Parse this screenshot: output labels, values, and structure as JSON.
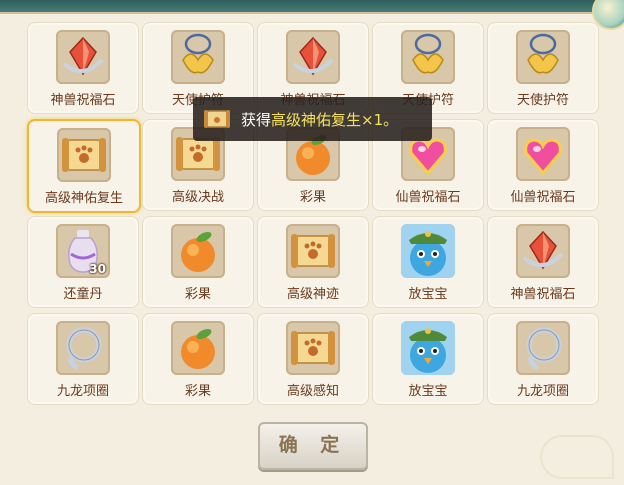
{
  "toast": {
    "icon": "scroll-icon",
    "prefix": "获得",
    "item": "高级神佑复生",
    "suffix": "×1。"
  },
  "button": {
    "confirm_label": "确 定"
  },
  "colors": {
    "selected_border": "#f2b72f",
    "toast_highlight": "#f5e25a",
    "label": "#6a3a1e"
  },
  "items": [
    {
      "name": "神兽祝福石",
      "icon": "red-crystal-icon"
    },
    {
      "name": "天使护符",
      "icon": "angel-wing-amulet-icon"
    },
    {
      "name": "神兽祝福石",
      "icon": "red-crystal-icon"
    },
    {
      "name": "天使护符",
      "icon": "angel-wing-amulet-icon"
    },
    {
      "name": "天使护符",
      "icon": "angel-wing-amulet-icon"
    },
    {
      "name": "高级神佑复生",
      "icon": "paw-scroll-icon",
      "selected": true
    },
    {
      "name": "高级决战",
      "icon": "paw-scroll-icon"
    },
    {
      "name": "彩果",
      "icon": "peach-fruit-icon"
    },
    {
      "name": "仙兽祝福石",
      "icon": "pink-heart-gem-icon"
    },
    {
      "name": "仙兽祝福石",
      "icon": "pink-heart-gem-icon"
    },
    {
      "name": "还童丹",
      "icon": "vase-potion-icon",
      "qty": "30"
    },
    {
      "name": "彩果",
      "icon": "peach-fruit-icon"
    },
    {
      "name": "高级神迹",
      "icon": "paw-scroll-icon"
    },
    {
      "name": "放宝宝",
      "icon": "blue-bird-pet-icon"
    },
    {
      "name": "神兽祝福石",
      "icon": "red-crystal-icon"
    },
    {
      "name": "九龙项圈",
      "icon": "silver-collar-icon"
    },
    {
      "name": "彩果",
      "icon": "peach-fruit-icon"
    },
    {
      "name": "高级感知",
      "icon": "paw-scroll-icon"
    },
    {
      "name": "放宝宝",
      "icon": "blue-bird-pet-icon"
    },
    {
      "name": "九龙项圈",
      "icon": "silver-collar-icon"
    }
  ]
}
